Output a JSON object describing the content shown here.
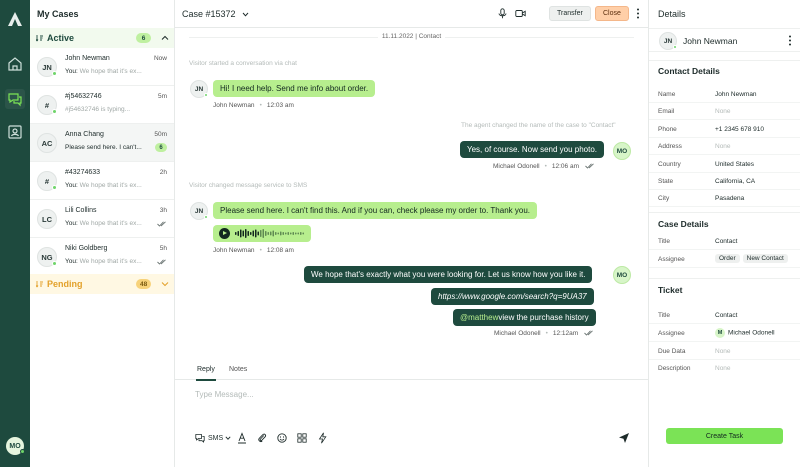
{
  "rail": {
    "user_initials": "MO"
  },
  "cases": {
    "title": "My Cases",
    "active_group": {
      "label": "Active",
      "count": "6"
    },
    "pending_group": {
      "label": "Pending",
      "count": "48"
    },
    "items": [
      {
        "initials": "JN",
        "name": "John Newman",
        "time": "Now",
        "you_prefix": "You:",
        "preview": "We hope that it's ex...",
        "online": true
      },
      {
        "initials": "#",
        "name": "#j54632746",
        "time": "5m",
        "you_prefix": "",
        "preview": "#j54632746 is typing...",
        "online": true
      },
      {
        "initials": "AC",
        "name": "Anna Chang",
        "time": "50m",
        "you_prefix": "",
        "preview": "Please send here. I can't...",
        "badge": "6",
        "online": false
      },
      {
        "initials": "#",
        "name": "#43274633",
        "time": "2h",
        "you_prefix": "You:",
        "preview": "We hope that it's ex...",
        "online": true
      },
      {
        "initials": "LC",
        "name": "Lili Collins",
        "time": "3h",
        "you_prefix": "You:",
        "preview": "We hope that it's ex...",
        "online": false
      },
      {
        "initials": "NG",
        "name": "Niki Goldberg",
        "time": "5h",
        "you_prefix": "You:",
        "preview": "We hope that it's ex...",
        "online": true
      }
    ]
  },
  "conversation": {
    "title": "Case #15372",
    "transfer_label": "Transfer",
    "close_label": "Close",
    "date_divider": "11.11.2022 | Contact",
    "system_messages": [
      "Visitor started a conversation via chat",
      "The agent changed the name of the case to \"Contact\"",
      "Visitor changed message service to SMS"
    ],
    "messages": [
      {
        "text": "Hi! I need help. Send me info about order.",
        "sender": "John Newman",
        "time": "12:03 am"
      },
      {
        "text": "Yes, of course. Now send you photo.",
        "sender": "Michael Odonell",
        "time": "12:06 am"
      },
      {
        "text": "Please send here. I can't find this. And if you can, check please my order to. Thank you.",
        "sender": "John Newman",
        "time": "12:08 am"
      },
      {
        "text": "We hope that's exactly what you were looking for. Let us know how you like it."
      },
      {
        "text": "https://www.google.com/search?q=9UA37"
      },
      {
        "mention": "@matthew",
        "text": " view the purchase history",
        "sender": "Michael Odonell",
        "time": "12:12am"
      }
    ],
    "customer_initials": "JN",
    "agent_initials": "MO",
    "voice_note": {
      "progress": 0.35
    }
  },
  "composer": {
    "tab_reply": "Reply",
    "tab_notes": "Notes",
    "placeholder": "Type Message...",
    "channel": "SMS"
  },
  "details": {
    "title": "Details",
    "contact_name": "John Newman",
    "contact_initials": "JN",
    "contact_details": {
      "heading": "Contact Details",
      "rows": [
        {
          "k": "Name",
          "v": "John Newman"
        },
        {
          "k": "Email",
          "v": "None"
        },
        {
          "k": "Phone",
          "v": "+1 2345 678 910"
        },
        {
          "k": "Address",
          "v": "None"
        },
        {
          "k": "Country",
          "v": "United States"
        },
        {
          "k": "State",
          "v": "California, CA"
        },
        {
          "k": "City",
          "v": "Pasadena"
        }
      ]
    },
    "case_details": {
      "heading": "Case Details",
      "title_k": "Title",
      "title_v": "Contact",
      "assignee_k": "Assignee",
      "assignee_chips": [
        "Order",
        "New Contact"
      ]
    },
    "ticket": {
      "heading": "Ticket",
      "title_k": "Title",
      "title_v": "Contact",
      "assignee_k": "Assignee",
      "assignee_initial": "M",
      "assignee_v": "Michael Odonell",
      "due_k": "Due Data",
      "due_v": "None",
      "desc_k": "Description",
      "desc_v": "None"
    },
    "create_task_label": "Create Task"
  },
  "colors": {
    "brand": "#1e4a3e",
    "accent": "#b7ee8e",
    "button_green": "#7be356",
    "close": "#ffcfa8",
    "pending": "#e3a12a"
  }
}
